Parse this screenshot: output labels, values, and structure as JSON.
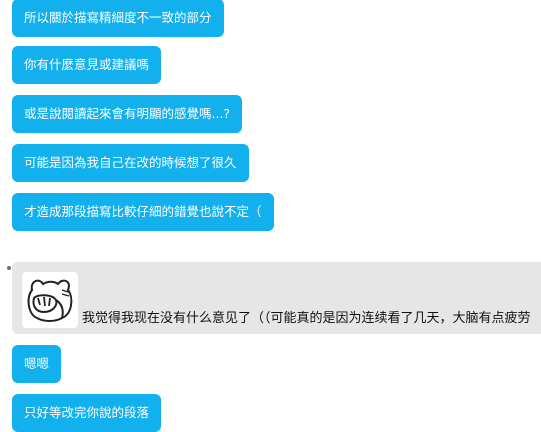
{
  "messages": [
    {
      "text": "所以關於描寫精細度不一致的部分"
    },
    {
      "text": "你有什麼意見或建議嗎"
    },
    {
      "text": "或是說閱讀起來會有明顯的感覺嗎...?"
    },
    {
      "text": "可能是因為我自己在改的時候想了很久"
    },
    {
      "text": "才造成那段描寫比較仔細的錯覺也說不定（"
    },
    {
      "text": "我觉得我现在没有什么意见了（（可能真的是因为连续看了几天，大脑有点疲劳"
    },
    {
      "text": "嗯嗯"
    },
    {
      "text": "只好等改完你說的段落"
    }
  ],
  "colors": {
    "outgoing_bubble": "#12b0ed",
    "incoming_bubble": "#e6e6e6"
  },
  "icons": {
    "sticker": "facepalm-bear-sticker-icon"
  }
}
